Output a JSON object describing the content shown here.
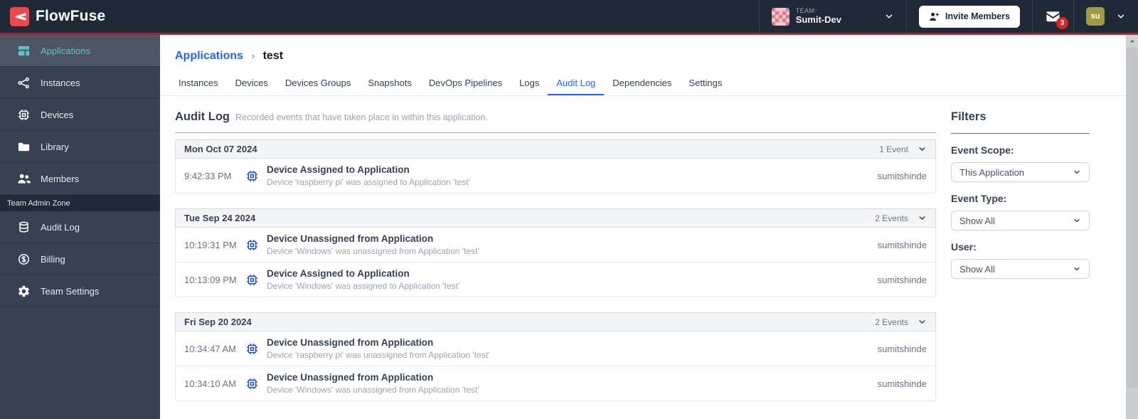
{
  "colors": {
    "brand_red": "#EA4A4E",
    "header_rule": "#8E3040",
    "header_bg": "#1F2937",
    "sidebar_bg": "#374151",
    "sidebar_active_bg": "#4B5563",
    "teal": "#5BC7C4",
    "link_blue": "#2563EB",
    "chip_blue": "#1D4ED8",
    "badge_red": "#DC2626",
    "avatar_olive": "#A39A45"
  },
  "header": {
    "brand": "FlowFuse",
    "team_label": "TEAM:",
    "team_name": "Sumit-Dev",
    "invite_button_label": "Invite Members",
    "notification_count": "3",
    "avatar_initials": "su"
  },
  "sidebar": {
    "items": [
      {
        "label": "Applications",
        "icon": "applications-icon",
        "active": true
      },
      {
        "label": "Instances",
        "icon": "instances-icon",
        "active": false
      },
      {
        "label": "Devices",
        "icon": "devices-icon",
        "active": false
      },
      {
        "label": "Library",
        "icon": "library-icon",
        "active": false
      },
      {
        "label": "Members",
        "icon": "members-icon",
        "active": false
      }
    ],
    "admin_section_label": "Team Admin Zone",
    "admin_items": [
      {
        "label": "Audit Log",
        "icon": "audit-log-icon",
        "active": false
      },
      {
        "label": "Billing",
        "icon": "billing-icon",
        "active": false
      },
      {
        "label": "Team Settings",
        "icon": "team-settings-icon",
        "active": false
      }
    ]
  },
  "breadcrumb": {
    "parent": "Applications",
    "separator": "›",
    "current": "test"
  },
  "tabs": {
    "items": [
      "Instances",
      "Devices",
      "Devices Groups",
      "Snapshots",
      "DevOps Pipelines",
      "Logs",
      "Audit Log",
      "Dependencies",
      "Settings"
    ],
    "active": "Audit Log"
  },
  "audit": {
    "title": "Audit Log",
    "subtitle": "Recorded events that have taken place in within this application.",
    "groups": [
      {
        "date": "Mon Oct 07 2024",
        "count_label": "1 Event",
        "events": [
          {
            "time": "9:42:33 PM",
            "icon": "device-chip-icon",
            "title": "Device Assigned to Application",
            "description": "Device 'raspberry pi' was assigned to Application 'test'",
            "user": "sumitshinde"
          }
        ]
      },
      {
        "date": "Tue Sep 24 2024",
        "count_label": "2 Events",
        "events": [
          {
            "time": "10:19:31 PM",
            "icon": "device-chip-icon",
            "title": "Device Unassigned from Application",
            "description": "Device 'Windows' was unassigned from Application 'test'",
            "user": "sumitshinde"
          },
          {
            "time": "10:13:09 PM",
            "icon": "device-chip-icon",
            "title": "Device Assigned to Application",
            "description": "Device 'Windows' was assigned to Application 'test'",
            "user": "sumitshinde"
          }
        ]
      },
      {
        "date": "Fri Sep 20 2024",
        "count_label": "2 Events",
        "events": [
          {
            "time": "10:34:47 AM",
            "icon": "device-chip-icon",
            "title": "Device Unassigned from Application",
            "description": "Device 'raspberry pi' was unassigned from Application 'test'",
            "user": "sumitshinde"
          },
          {
            "time": "10:34:10 AM",
            "icon": "device-chip-icon",
            "title": "Device Unassigned from Application",
            "description": "Device 'Windows' was unassigned from Application 'test'",
            "user": "sumitshinde"
          }
        ]
      }
    ]
  },
  "filters": {
    "title": "Filters",
    "fields": [
      {
        "name": "event-scope",
        "label": "Event Scope:",
        "value": "This Application"
      },
      {
        "name": "event-type",
        "label": "Event Type:",
        "value": "Show All"
      },
      {
        "name": "user",
        "label": "User:",
        "value": "Show All"
      }
    ]
  }
}
